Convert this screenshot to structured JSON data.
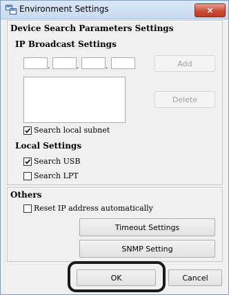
{
  "window": {
    "title": "Environment Settings",
    "close_symbol": "×",
    "icon": "environment-settings-icon"
  },
  "device_search": {
    "group_title": "Device Search Parameters Settings",
    "ip_broadcast": {
      "title": "IP Broadcast Settings",
      "ip_octets": [
        "",
        "",
        "",
        ""
      ],
      "add_label": "Add",
      "delete_label": "Delete",
      "address_list": [],
      "search_local_subnet": {
        "label": "Search local subnet",
        "checked": true
      }
    },
    "local": {
      "title": "Local Settings",
      "search_usb": {
        "label": "Search USB",
        "checked": true
      },
      "search_lpt": {
        "label": "Search LPT",
        "checked": false
      }
    }
  },
  "others": {
    "group_title": "Others",
    "reset_ip": {
      "label": "Reset IP address automatically",
      "checked": false
    },
    "timeout_label": "Timeout Settings",
    "snmp_label": "SNMP Setting"
  },
  "footer": {
    "ok_label": "OK",
    "cancel_label": "Cancel"
  }
}
